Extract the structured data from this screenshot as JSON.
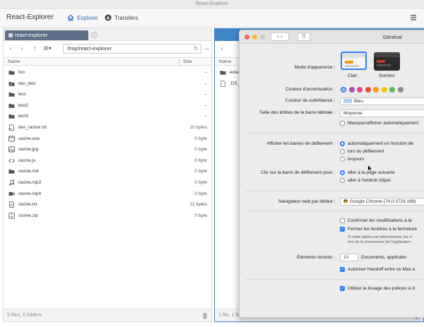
{
  "window": {
    "title": "React-Explorer"
  },
  "nav": {
    "brand": "React-Explorer",
    "explorer_label": "Explorer",
    "transfers_label": "Transfers",
    "accent": "#2c6fb8"
  },
  "left": {
    "tab_label": "react-explorer",
    "path": "/tmp/react-explorer",
    "col_name": "Name",
    "col_size": "Size",
    "files": [
      {
        "name": "foo",
        "size": "--",
        "icon": "folder-icon"
      },
      {
        "name": "lien_test",
        "size": "--",
        "icon": "folder-link-icon"
      },
      {
        "name": "test",
        "size": "--",
        "icon": "folder-icon"
      },
      {
        "name": "test2",
        "size": "--",
        "icon": "folder-icon"
      },
      {
        "name": "test3",
        "size": "--",
        "icon": "folder-icon"
      },
      {
        "name": "lien_racine.txt",
        "size": "10 bytes",
        "icon": "file-link-icon"
      },
      {
        "name": "racine.exe",
        "size": "0 byte",
        "icon": "executable-icon"
      },
      {
        "name": "racine.jpg",
        "size": "0 byte",
        "icon": "image-icon"
      },
      {
        "name": "racine.js",
        "size": "0 byte",
        "icon": "code-icon"
      },
      {
        "name": "racine.md",
        "size": "0 byte",
        "icon": "folder-icon"
      },
      {
        "name": "racine.mp3",
        "size": "0 byte",
        "icon": "music-icon"
      },
      {
        "name": "racine.mp4",
        "size": "0 byte",
        "icon": "video-icon"
      },
      {
        "name": "racine.txt",
        "size": "11 bytes",
        "icon": "text-file-icon"
      },
      {
        "name": "racine.zip",
        "size": "0 byte",
        "icon": "archive-icon"
      }
    ],
    "status": "9 files, 5 folders"
  },
  "right": {
    "col_name": "Name",
    "files": [
      {
        "name": "exter",
        "icon": "folder-icon"
      },
      {
        "name": ".DS_S",
        "icon": "file-icon"
      }
    ],
    "status": "1 file, 1 folder"
  },
  "prefs": {
    "title": "Général",
    "appearance_label": "Mode d'apparence :",
    "appearance_light": "Clair",
    "appearance_dark": "Sombre",
    "accent_label": "Couleur d'accentuation :",
    "accent_colors": [
      "#2f7cf6",
      "#9b59b6",
      "#e84393",
      "#e74c3c",
      "#f39c12",
      "#f1c40f",
      "#5cb85c",
      "#8e8e8e"
    ],
    "highlight_label": "Couleur de surbrillance :",
    "highlight_value": "Bleu",
    "sidebar_icon_label": "Taille des icônes de la barre latérale :",
    "sidebar_icon_value": "Moyenne",
    "auto_hide_label": "Masquer/afficher automatiquement",
    "scrollbars_label": "Afficher les barres de défilement :",
    "scroll_opt1": "automatiquement en fonction de",
    "scroll_opt2": "lors du défilement",
    "scroll_opt3": "toujours",
    "click_label": "Clic sur la barre de défilement pour :",
    "click_opt1": "aller à la page suivante",
    "click_opt2": "aller à l'endroit cliqué",
    "browser_label": "Navigateur web par défaut :",
    "browser_value": "Google Chrome (74.0.3729.169)",
    "confirm_label": "Confirmer les modifications à la",
    "close_windows_label": "Fermer les fenêtres à la fermeture",
    "close_note1": "Si cette option est sélectionnée, les d",
    "close_note2": "lors de la réouverture de l'application",
    "recent_label": "Éléments récents :",
    "recent_value": "10",
    "recent_suffix": "Documents, applicatio",
    "handoff_label": "Autoriser Handoff entre ce Mac e",
    "smoothing_label": "Utiliser le lissage des polices si d"
  }
}
